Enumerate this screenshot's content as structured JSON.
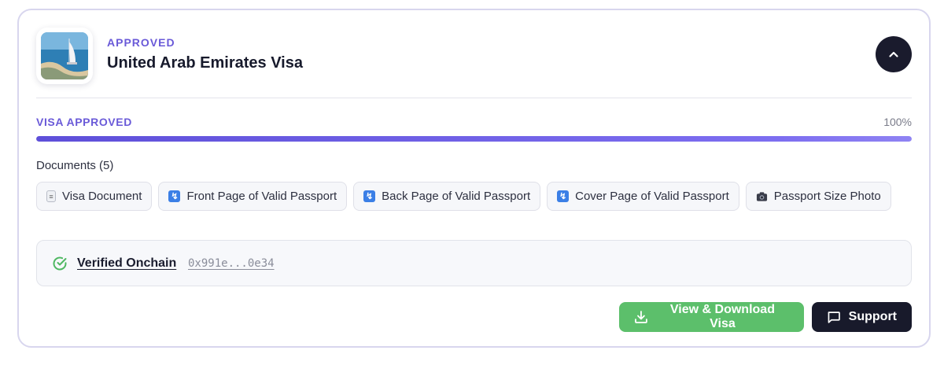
{
  "visa": {
    "status": "APPROVED",
    "title": "United Arab Emirates Visa",
    "thumbnail_alt": "Burj Al Arab, Dubai"
  },
  "progress": {
    "label": "VISA APPROVED",
    "percent_text": "100%",
    "percent": 100
  },
  "documents": {
    "title": "Documents (5)",
    "items": [
      {
        "label": "Visa Document",
        "icon": "file-icon"
      },
      {
        "label": "Front Page of Valid Passport",
        "icon": "passport-icon"
      },
      {
        "label": "Back Page of Valid Passport",
        "icon": "passport-icon"
      },
      {
        "label": "Cover Page of Valid Passport",
        "icon": "passport-icon"
      },
      {
        "label": "Passport Size Photo",
        "icon": "camera-icon"
      }
    ]
  },
  "verification": {
    "label": "Verified Onchain",
    "hash": "0x991e...0e34"
  },
  "actions": {
    "download_label": "View & Download Visa",
    "support_label": "Support"
  },
  "colors": {
    "accent": "#6a5ad8",
    "success": "#5cbf6b",
    "dark": "#181a2b"
  }
}
